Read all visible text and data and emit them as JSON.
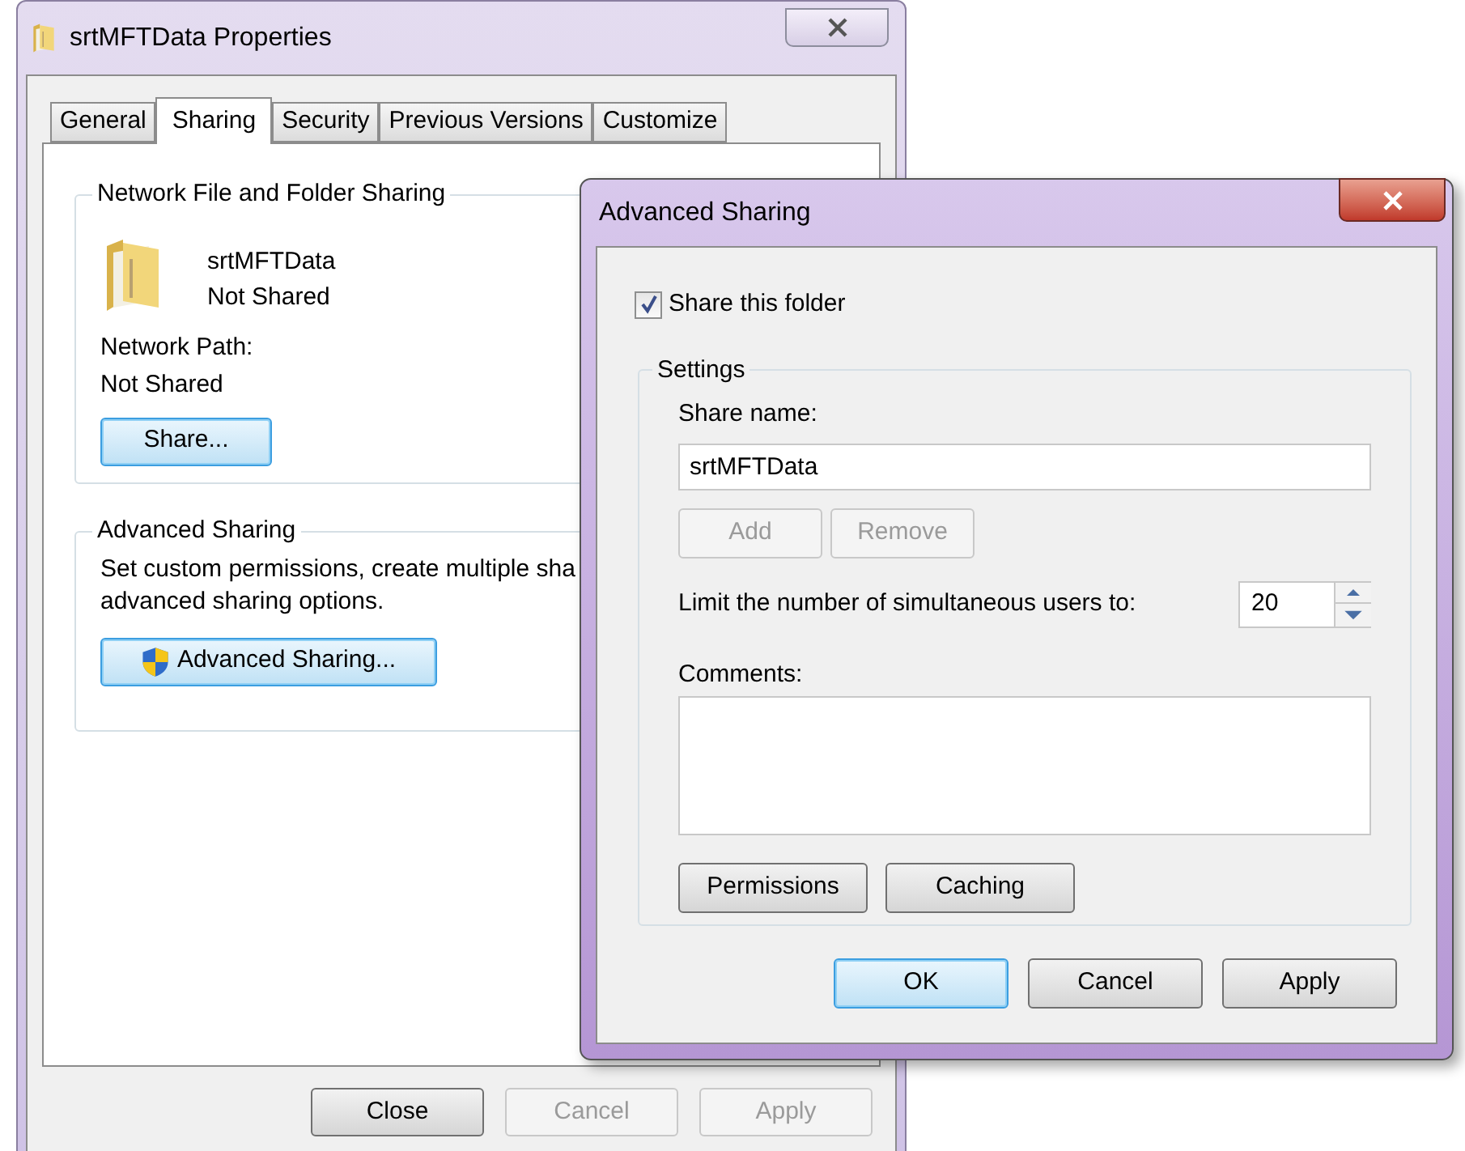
{
  "properties_window": {
    "title": "srtMFTData Properties",
    "tabs": [
      {
        "label": "General",
        "selected": false
      },
      {
        "label": "Sharing",
        "selected": true
      },
      {
        "label": "Security",
        "selected": false
      },
      {
        "label": "Previous Versions",
        "selected": false
      },
      {
        "label": "Customize",
        "selected": false
      }
    ],
    "network_sharing": {
      "heading": "Network File and Folder Sharing",
      "folder_name": "srtMFTData",
      "status": "Not Shared",
      "path_label": "Network Path:",
      "path_value": "Not Shared",
      "share_button": "Share..."
    },
    "advanced_sharing": {
      "heading": "Advanced Sharing",
      "description_lines": [
        "Set custom permissions, create multiple sha",
        "advanced sharing options."
      ],
      "button": "Advanced Sharing..."
    },
    "buttons": [
      {
        "label": "Close",
        "disabled": false
      },
      {
        "label": "Cancel",
        "disabled": true
      },
      {
        "label": "Apply",
        "disabled": true
      }
    ]
  },
  "advanced_sharing_dialog": {
    "title": "Advanced Sharing",
    "share_checkbox": {
      "label": "Share this folder",
      "checked": true
    },
    "settings": {
      "heading": "Settings",
      "share_name_label": "Share name:",
      "share_name_value": "srtMFTData",
      "name_buttons": [
        {
          "label": "Add",
          "disabled": true
        },
        {
          "label": "Remove",
          "disabled": true
        }
      ],
      "limit_label": "Limit the number of simultaneous users to:",
      "limit_value": "20",
      "comments_label": "Comments:",
      "option_buttons": [
        {
          "label": "Permissions",
          "disabled": false
        },
        {
          "label": "Caching",
          "disabled": false
        }
      ]
    },
    "buttons": [
      {
        "label": "OK",
        "default": true
      },
      {
        "label": "Cancel",
        "default": false
      },
      {
        "label": "Apply",
        "default": false
      }
    ]
  }
}
